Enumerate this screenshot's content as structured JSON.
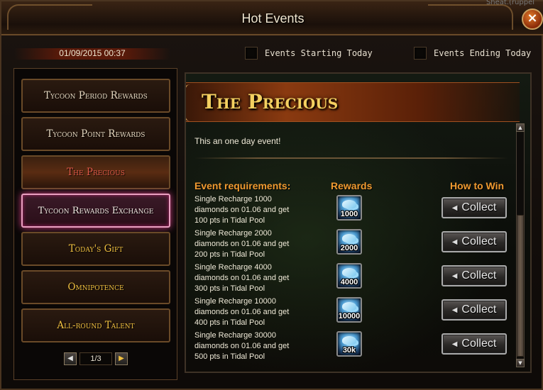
{
  "window": {
    "title": "Hot Events",
    "close_icon": "×",
    "corner_text": "Sheat.(ruppel"
  },
  "header": {
    "datetime": "01/09/2015 00:37",
    "filters": [
      {
        "label": "Events Starting Today",
        "checked": false
      },
      {
        "label": "Events Ending Today",
        "checked": false
      }
    ]
  },
  "sidebar": {
    "items": [
      {
        "label": "Tycoon Period Rewards",
        "state": "normal"
      },
      {
        "label": "Tycoon Point Rewards",
        "state": "normal"
      },
      {
        "label": "The Precious",
        "state": "selected"
      },
      {
        "label": "Tycoon Rewards Exchange",
        "state": "highlighted"
      },
      {
        "label": "Today's Gift",
        "state": "normal"
      },
      {
        "label": "Omnipotence",
        "state": "normal"
      },
      {
        "label": "All-round Talent",
        "state": "normal"
      }
    ],
    "pager": {
      "prev_icon": "◀",
      "page": "1/3",
      "next_icon": "▶"
    }
  },
  "event": {
    "title": "The Precious",
    "description": "This an one day event!",
    "columns": {
      "requirements": "Event requirements:",
      "rewards": "Rewards",
      "how_to_win": "How to Win"
    },
    "rows": [
      {
        "req_line1": "Single Recharge 1000",
        "req_line2": "diamonds on 01.06 and get",
        "req_line3": "100 pts in Tidal Pool",
        "reward_qty": "1000",
        "action": "Collect"
      },
      {
        "req_line1": "Single Recharge 2000",
        "req_line2": "diamonds on 01.06 and get",
        "req_line3": "200 pts in Tidal Pool",
        "reward_qty": "2000",
        "action": "Collect"
      },
      {
        "req_line1": "Single Recharge 4000",
        "req_line2": "diamonds on 01.06 and get",
        "req_line3": "300 pts in Tidal Pool",
        "reward_qty": "4000",
        "action": "Collect"
      },
      {
        "req_line1": "Single Recharge 10000",
        "req_line2": "diamonds on 01.06 and get",
        "req_line3": "400 pts in Tidal Pool",
        "reward_qty": "10000",
        "action": "Collect"
      },
      {
        "req_line1": "Single Recharge 30000",
        "req_line2": "diamonds on 01.06 and get",
        "req_line3": "500 pts in Tidal Pool",
        "reward_qty": "30k",
        "action": "Collect"
      }
    ],
    "scroll_up_icon": "▲",
    "scroll_down_icon": "▼"
  },
  "colors": {
    "accent_orange": "#f09a30",
    "title_gold": "#f4d060",
    "selected_red": "#e05a4a"
  }
}
